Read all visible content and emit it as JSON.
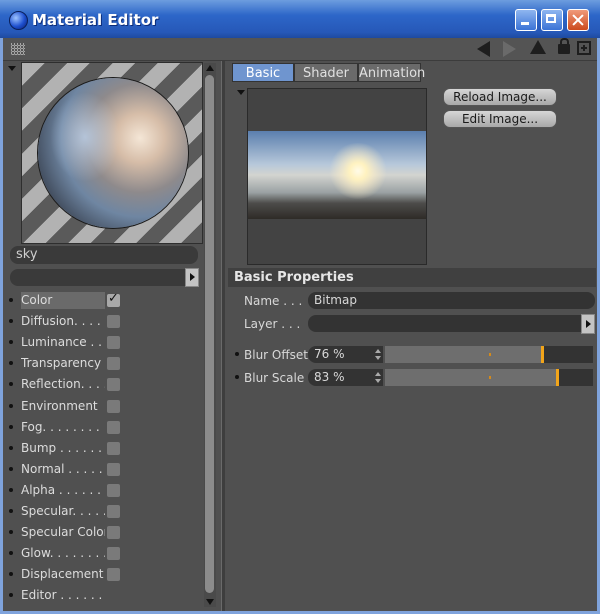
{
  "window": {
    "title": "Material Editor"
  },
  "material": {
    "name": "sky",
    "channels": [
      {
        "label": "Color",
        "checked": true,
        "active": true
      },
      {
        "label": "Diffusion. . . . .",
        "checked": false
      },
      {
        "label": "Luminance . . .",
        "checked": false
      },
      {
        "label": "Transparency",
        "checked": false
      },
      {
        "label": "Reflection. . . .",
        "checked": false
      },
      {
        "label": "Environment",
        "checked": false
      },
      {
        "label": "Fog. . . . . . . .",
        "checked": false
      },
      {
        "label": "Bump . . . . . . .",
        "checked": false
      },
      {
        "label": "Normal . . . . . .",
        "checked": false
      },
      {
        "label": "Alpha . . . . . . .",
        "checked": false
      },
      {
        "label": "Specular. . . . .",
        "checked": false
      },
      {
        "label": "Specular Color",
        "checked": false
      },
      {
        "label": "Glow. . . . . . . .",
        "checked": false
      },
      {
        "label": "Displacement",
        "checked": false
      },
      {
        "label": "Editor . . . . . . .",
        "checked": null
      }
    ]
  },
  "tabs": [
    {
      "label": "Basic",
      "active": true
    },
    {
      "label": "Shader",
      "active": false
    },
    {
      "label": "Animation",
      "active": false
    }
  ],
  "buttons": {
    "reload": "Reload Image...",
    "edit": "Edit Image..."
  },
  "section": {
    "title": "Basic Properties"
  },
  "properties": {
    "name_label": "Name . . .",
    "name_value": "Bitmap",
    "layer_label": "Layer . . .",
    "layer_value": "",
    "blur_offset_label": "Blur Offset",
    "blur_offset_value": "76 %",
    "blur_offset_fraction": 0.76,
    "blur_scale_label": "Blur Scale",
    "blur_scale_value": "83 %",
    "blur_scale_fraction": 0.83
  },
  "colors": {
    "accent_tab": "#6f95cf",
    "slider_knob": "#f2a51a"
  }
}
